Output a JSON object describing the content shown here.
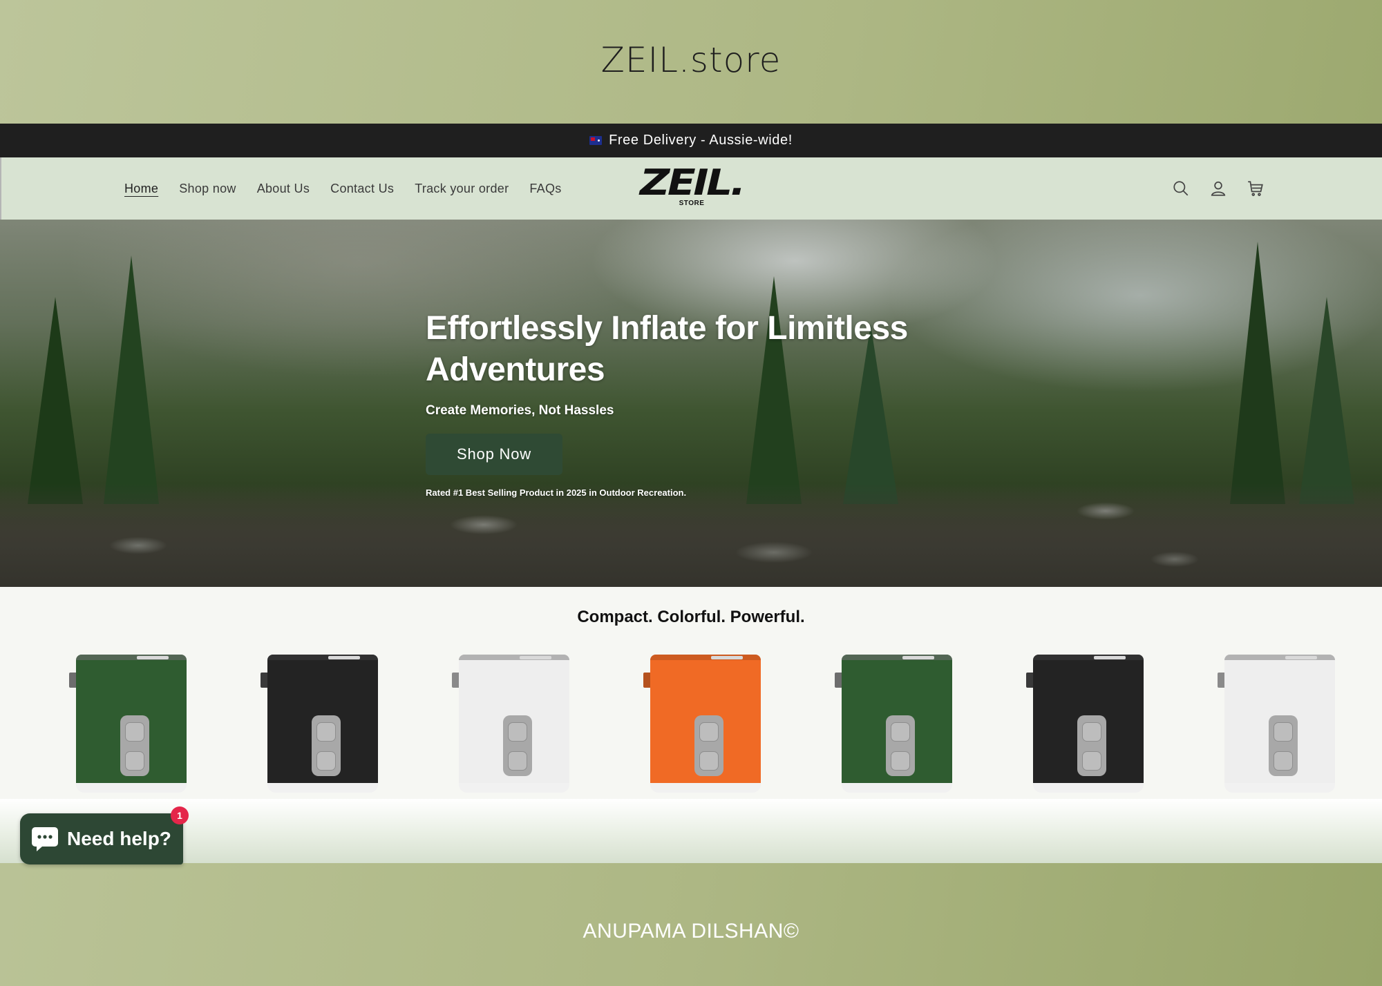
{
  "frame": {
    "title": "ZEIL.store",
    "footer": "ANUPAMA DILSHAN©"
  },
  "announcement": {
    "text": "Free Delivery - Aussie-wide!",
    "flag_icon": "australia-flag-icon"
  },
  "nav": {
    "items": [
      {
        "label": "Home",
        "active": true
      },
      {
        "label": "Shop now",
        "active": false
      },
      {
        "label": "About Us",
        "active": false
      },
      {
        "label": "Contact Us",
        "active": false
      },
      {
        "label": "Track your order",
        "active": false
      },
      {
        "label": "FAQs",
        "active": false
      }
    ]
  },
  "logo": {
    "main": "ZEIL.",
    "sub": "STORE"
  },
  "header_icons": [
    "search-icon",
    "account-icon",
    "cart-icon"
  ],
  "hero": {
    "title": "Effortlessly Inflate for Limitless Adventures",
    "subtitle": "Create Memories, Not Hassles",
    "button_label": "Shop Now",
    "note": "Rated #1 Best Selling Product in 2025 in Outdoor Recreation."
  },
  "products": {
    "title": "Compact. Colorful. Powerful.",
    "items": [
      {
        "name": "green-pump",
        "color": "#2f5c30",
        "accent": "#6d6d6d"
      },
      {
        "name": "black-pump",
        "color": "#232323",
        "accent": "#3a3a3a"
      },
      {
        "name": "white-pump",
        "color": "#eeeeee",
        "accent": "#8a8a8a"
      },
      {
        "name": "orange-pump",
        "color": "#f06a25",
        "accent": "#b5521e"
      },
      {
        "name": "green-pump",
        "color": "#2f5c30",
        "accent": "#6d6d6d"
      },
      {
        "name": "black-pump",
        "color": "#232323",
        "accent": "#3a3a3a"
      },
      {
        "name": "white-pump",
        "color": "#eeeeee",
        "accent": "#8a8a8a"
      }
    ]
  },
  "chat": {
    "label": "Need help?",
    "badge": "1"
  },
  "colors": {
    "announcement_bg": "#1f1f1f",
    "header_bg": "#d8e3d2",
    "button_bg": "#2f4a34",
    "badge": "#e4264a"
  }
}
